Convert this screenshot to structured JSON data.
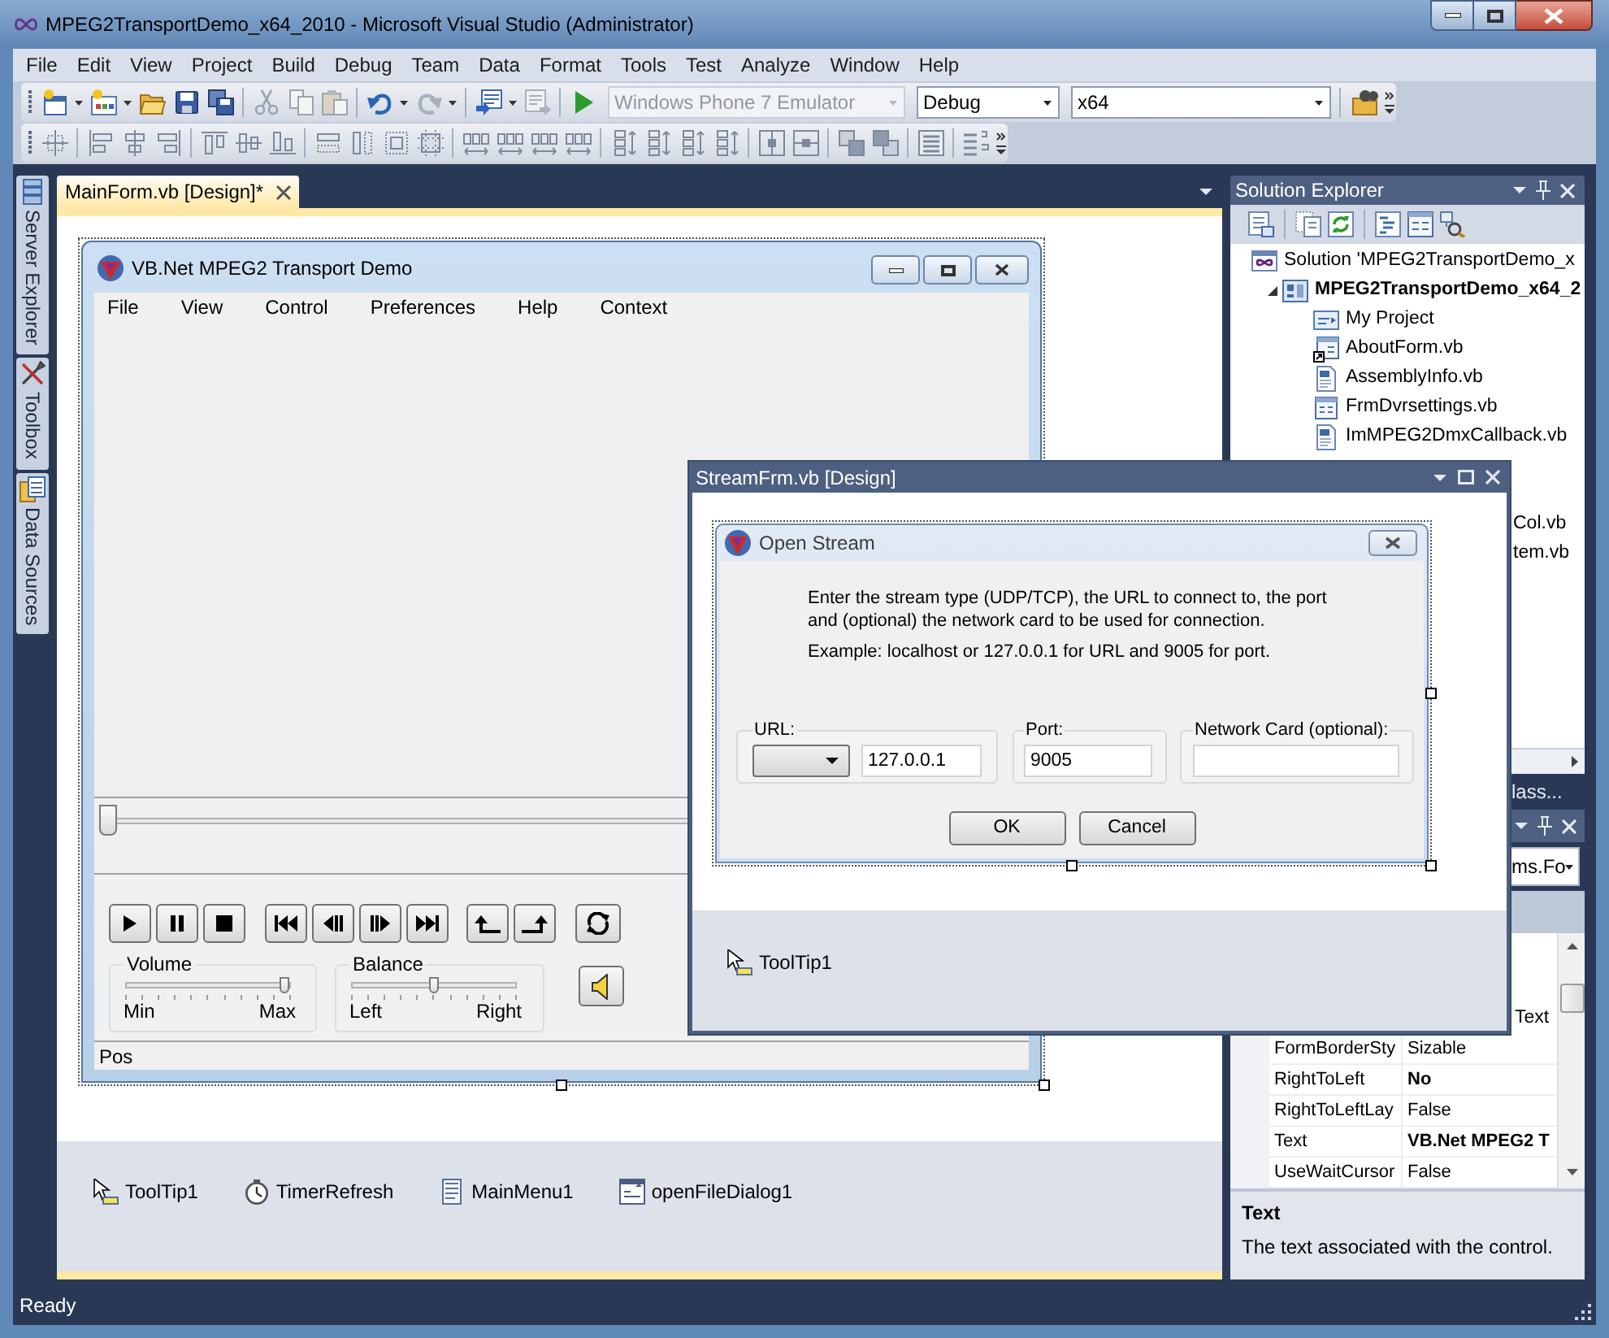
{
  "window": {
    "title": "MPEG2TransportDemo_x64_2010 - Microsoft Visual Studio (Administrator)"
  },
  "menu": [
    "File",
    "Edit",
    "View",
    "Project",
    "Build",
    "Debug",
    "Team",
    "Data",
    "Format",
    "Tools",
    "Test",
    "Analyze",
    "Window",
    "Help"
  ],
  "toolbar": {
    "combos": [
      {
        "value": "Windows Phone 7 Emulator",
        "disabled": true
      },
      {
        "value": "Debug",
        "disabled": false
      },
      {
        "value": "x64",
        "disabled": false
      }
    ]
  },
  "side_tabs": [
    "Server Explorer",
    "Toolbox",
    "Data Sources"
  ],
  "document_tabs": [
    {
      "label": "MainForm.vb [Design]*",
      "selected": true
    }
  ],
  "main_form": {
    "title": "VB.Net MPEG2 Transport Demo",
    "menu": [
      "File",
      "View",
      "Control",
      "Preferences",
      "Help",
      "Context"
    ],
    "position": {
      "level": 0
    },
    "volume": {
      "label": "Volume",
      "min": "Min",
      "max": "Max",
      "level": 0.96
    },
    "balance": {
      "label": "Balance",
      "min": "Left",
      "max": "Right",
      "level": 0.5
    },
    "status": "Pos"
  },
  "component_tray": [
    {
      "label": "ToolTip1",
      "kind": "tooltip"
    },
    {
      "label": "TimerRefresh",
      "kind": "timer"
    },
    {
      "label": "MainMenu1",
      "kind": "menu"
    },
    {
      "label": "openFileDialog1",
      "kind": "dialog"
    }
  ],
  "solution_explorer": {
    "title": "Solution Explorer",
    "tree": [
      {
        "label": "Solution 'MPEG2TransportDemo_x",
        "kind": "solution",
        "children": [
          {
            "label": "MPEG2TransportDemo_x64_2",
            "kind": "project",
            "expanded": true,
            "children": [
              {
                "label": "My Project",
                "kind": "my_project"
              },
              {
                "label": "AboutForm.vb",
                "kind": "form_link"
              },
              {
                "label": "AssemblyInfo.vb",
                "kind": "code"
              },
              {
                "label": "FrmDvrsettings.vb",
                "kind": "form"
              },
              {
                "label": "ImMPEG2DmxCallback.vb",
                "kind": "code"
              },
              {
                "label": "Col.vb",
                "kind": "clipped"
              },
              {
                "label": "tem.vb",
                "kind": "clipped"
              }
            ]
          }
        ]
      }
    ],
    "bottom_tabs": [
      "lass..."
    ]
  },
  "properties": {
    "object": "ms.Fo",
    "rows": [
      {
        "kind": "clipped",
        "value": "Text"
      },
      {
        "kind": "row",
        "name": "FormBorderSty",
        "value": "Sizable",
        "bold": false
      },
      {
        "kind": "row",
        "name": "RightToLeft",
        "value": "No",
        "bold": true
      },
      {
        "kind": "row",
        "name": "RightToLeftLay",
        "value": "False",
        "bold": false
      },
      {
        "kind": "row",
        "name": "Text",
        "value": "VB.Net MPEG2 T",
        "bold": true
      },
      {
        "kind": "row",
        "name": "UseWaitCursor",
        "value": "False",
        "bold": false
      }
    ],
    "description": {
      "title": "Text",
      "text": "The text associated with the control."
    }
  },
  "stream_window": {
    "title": "StreamFrm.vb [Design]",
    "dialog": {
      "title": "Open Stream",
      "message": "Enter the stream type (UDP/TCP), the URL to connect to, the port and (optional) the network card to be used for connection.",
      "example": "Example: localhost or 127.0.0.1 for URL and 9005 for port.",
      "groups": [
        {
          "label": "URL:",
          "kind": "combo_text",
          "value": "127.0.0.1"
        },
        {
          "label": "Port:",
          "kind": "text",
          "value": "9005"
        },
        {
          "label": "Network Card (optional):",
          "kind": "text"
        }
      ],
      "buttons": [
        "OK",
        "Cancel"
      ]
    },
    "tray": [
      {
        "label": "ToolTip1",
        "kind": "tooltip"
      }
    ]
  },
  "status_bar": {
    "text": "Ready"
  }
}
